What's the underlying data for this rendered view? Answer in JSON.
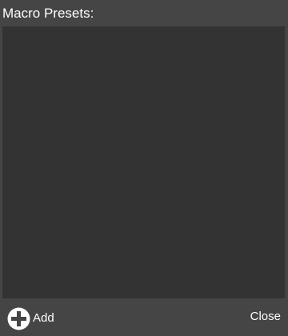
{
  "dialog": {
    "title": "Macro Presets:"
  },
  "presets": {
    "items": []
  },
  "footer": {
    "add_label": "Add",
    "add_icon": "plus-circle-icon",
    "close_label": "Close"
  },
  "colors": {
    "panel_background": "#454545",
    "list_background": "#333333",
    "text": "#ffffff"
  }
}
